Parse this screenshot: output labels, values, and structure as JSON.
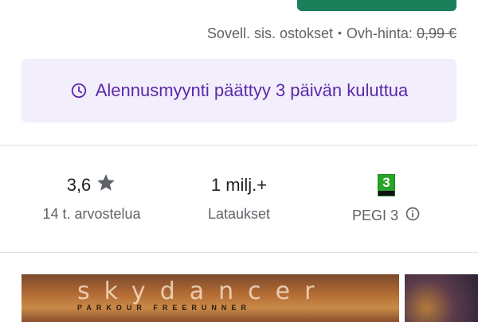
{
  "purchase_info": {
    "in_app_purchases": "Sovell. sis. ostokset",
    "separator": "•",
    "original_price_label": "Ovh-hinta:",
    "original_price": "0,99 €"
  },
  "sale_banner": {
    "icon": "clock-icon",
    "text": "Alennusmyynti päättyy 3 päivän kuluttua",
    "color": "#5b2aa8",
    "background": "#f3eefc"
  },
  "stats": {
    "rating": {
      "value": "3,6",
      "icon": "star-icon",
      "label": "14 t. arvostelua"
    },
    "downloads": {
      "value": "1 milj.+",
      "label": "Lataukset"
    },
    "content_rating": {
      "badge_number": "3",
      "label": "PEGI 3",
      "info_icon": "info-icon"
    }
  },
  "screenshots": {
    "first": {
      "title": "skydancer",
      "subtitle": "PARKOUR FREERUNNER"
    }
  },
  "colors": {
    "install_button": "#1a7f5a",
    "pegi_green": "#27a52a"
  }
}
